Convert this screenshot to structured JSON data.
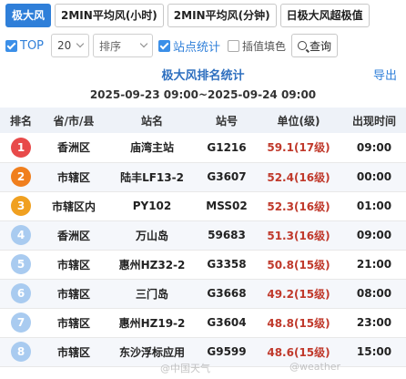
{
  "tabs": [
    {
      "label": "极大风",
      "active": true
    },
    {
      "label": "2MIN平均风(小时)",
      "active": false
    },
    {
      "label": "2MIN平均风(分钟)",
      "active": false
    },
    {
      "label": "日极大风超极值",
      "active": false
    }
  ],
  "controls": {
    "top_label": "TOP",
    "top_checked": true,
    "count_value": "20",
    "sort_placeholder": "排序",
    "station_stat_label": "站点统计",
    "station_stat_checked": true,
    "interp_fill_label": "插值填色",
    "interp_fill_checked": false,
    "query_label": "查询"
  },
  "report": {
    "title": "极大风排名统计",
    "export_label": "导出",
    "range": "2025-09-23 09:00~2025-09-24 09:00"
  },
  "table": {
    "headers": [
      "排名",
      "省/市/县",
      "站名",
      "站号",
      "单位(级)",
      "出现时间"
    ],
    "rows": [
      {
        "rank": "1",
        "area": "香洲区",
        "name": "庙湾主站",
        "id": "G1216",
        "value": "59.1(17级)",
        "time": "09:00",
        "badge": "#e84a4a"
      },
      {
        "rank": "2",
        "area": "市辖区",
        "name": "陆丰LF13-2",
        "id": "G3607",
        "value": "52.4(16级)",
        "time": "00:00",
        "badge": "#f07f1e"
      },
      {
        "rank": "3",
        "area": "市辖区内",
        "name": "PY102",
        "id": "MSS02",
        "value": "52.3(16级)",
        "time": "01:00",
        "badge": "#f0a020"
      },
      {
        "rank": "4",
        "area": "香洲区",
        "name": "万山岛",
        "id": "59683",
        "value": "51.3(16级)",
        "time": "09:00",
        "badge": "#a9cbf0"
      },
      {
        "rank": "5",
        "area": "市辖区",
        "name": "惠州HZ32-2",
        "id": "G3358",
        "value": "50.8(15级)",
        "time": "21:00",
        "badge": "#a9cbf0"
      },
      {
        "rank": "6",
        "area": "市辖区",
        "name": "三门岛",
        "id": "G3668",
        "value": "49.2(15级)",
        "time": "08:00",
        "badge": "#a9cbf0"
      },
      {
        "rank": "7",
        "area": "市辖区",
        "name": "惠州HZ19-2",
        "id": "G3604",
        "value": "48.8(15级)",
        "time": "23:00",
        "badge": "#a9cbf0"
      },
      {
        "rank": "8",
        "area": "市辖区",
        "name": "东沙浮标应用",
        "id": "G9599",
        "value": "48.6(15级)",
        "time": "15:00",
        "badge": "#a9cbf0"
      }
    ]
  }
}
